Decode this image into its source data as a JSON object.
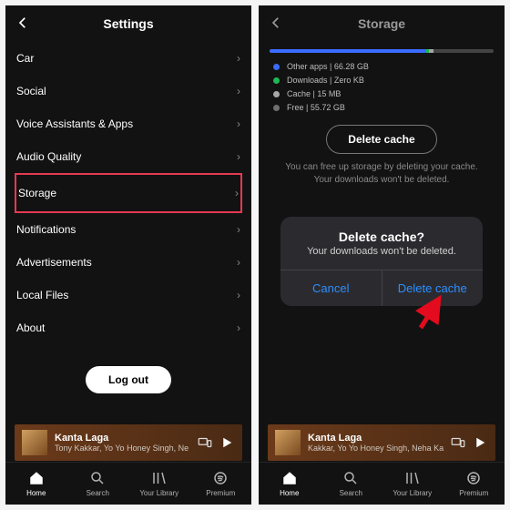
{
  "left": {
    "title": "Settings",
    "items": [
      {
        "label": "Car"
      },
      {
        "label": "Social"
      },
      {
        "label": "Voice Assistants & Apps"
      },
      {
        "label": "Audio Quality"
      },
      {
        "label": "Storage",
        "highlight": true
      },
      {
        "label": "Notifications"
      },
      {
        "label": "Advertisements"
      },
      {
        "label": "Local Files"
      },
      {
        "label": "About"
      }
    ],
    "logout": "Log out"
  },
  "right": {
    "title": "Storage",
    "bar": [
      {
        "color": "#3a6cff",
        "width": 70
      },
      {
        "color": "#1db954",
        "width": 1
      },
      {
        "color": "#a6a6a6",
        "width": 2
      }
    ],
    "legend": [
      {
        "color": "#3a6cff",
        "label": "Other apps",
        "value": "66.28 GB"
      },
      {
        "color": "#1db954",
        "label": "Downloads",
        "value": "Zero KB"
      },
      {
        "color": "#a6a6a6",
        "label": "Cache",
        "value": "15 MB"
      },
      {
        "color": "#6f6f6f",
        "label": "Free",
        "value": "55.72 GB"
      }
    ],
    "delete_label": "Delete cache",
    "hint": "You can free up storage by deleting your cache. Your downloads won't be deleted.",
    "dialog": {
      "title": "Delete cache?",
      "message": "Your downloads won't be deleted.",
      "cancel": "Cancel",
      "confirm": "Delete cache"
    }
  },
  "nowplaying": {
    "title": "Kanta Laga",
    "artist_left": "Tony Kakkar, Yo Yo Honey Singh, Ne",
    "artist_right": "Kakkar, Yo Yo Honey Singh, Neha Ka"
  },
  "tabs": [
    {
      "label": "Home"
    },
    {
      "label": "Search"
    },
    {
      "label": "Your Library"
    },
    {
      "label": "Premium"
    }
  ]
}
